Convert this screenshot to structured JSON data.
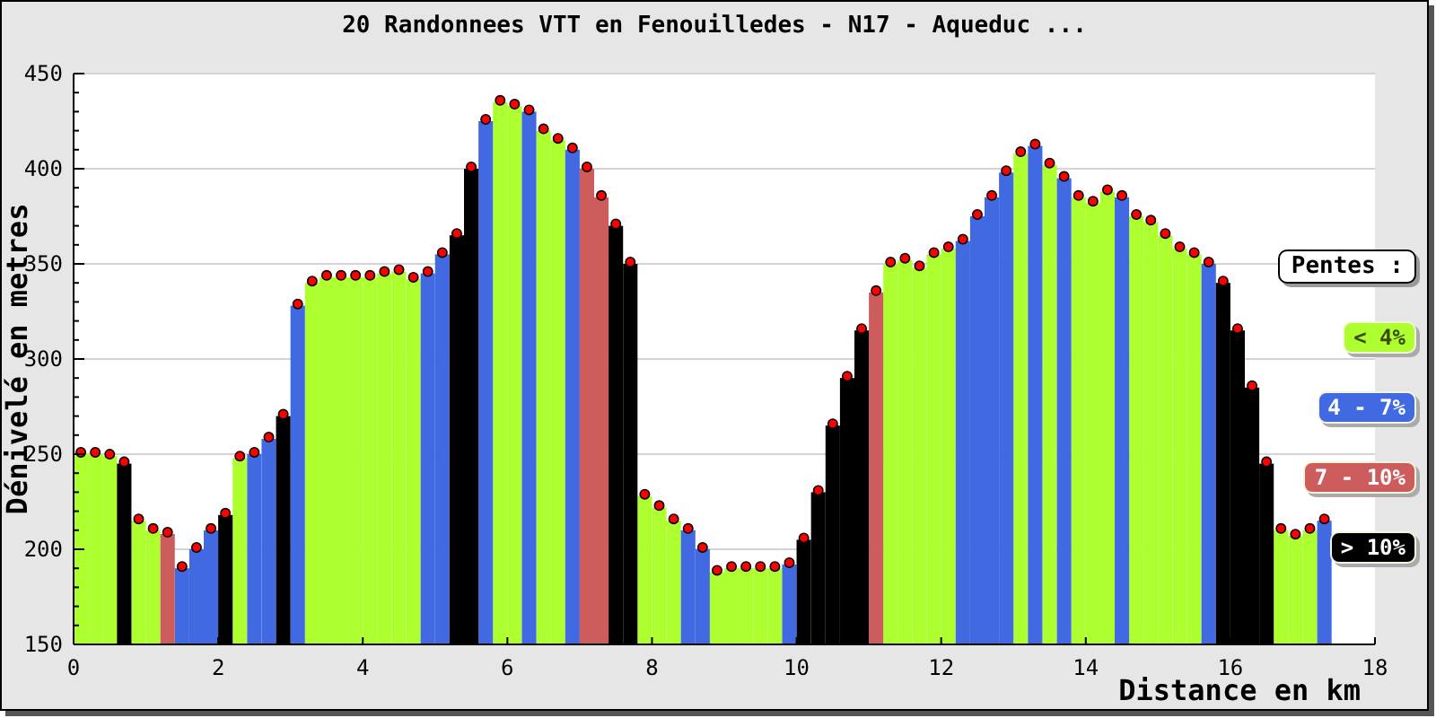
{
  "title": "20 Randonnees VTT en Fenouilledes - N17 - Aqueduc ...",
  "chart_data": {
    "type": "bar",
    "grid": true,
    "xlabel": "Distance en km",
    "ylabel": "Dénivelé en metres",
    "x": [
      0.1,
      0.3,
      0.5,
      0.7,
      0.9,
      1.1,
      1.3,
      1.5,
      1.7,
      1.9,
      2.1,
      2.3,
      2.5,
      2.7,
      2.9,
      3.1,
      3.3,
      3.5,
      3.7,
      3.9,
      4.1,
      4.3,
      4.5,
      4.7,
      4.9,
      5.1,
      5.3,
      5.5,
      5.7,
      5.9,
      6.1,
      6.3,
      6.5,
      6.7,
      6.9,
      7.1,
      7.3,
      7.5,
      7.7,
      7.9,
      8.1,
      8.3,
      8.5,
      8.7,
      8.9,
      9.1,
      9.3,
      9.5,
      9.7,
      9.9,
      10.1,
      10.3,
      10.5,
      10.7,
      10.9,
      11.1,
      11.3,
      11.5,
      11.7,
      11.9,
      12.1,
      12.3,
      12.5,
      12.7,
      12.9,
      13.1,
      13.3,
      13.5,
      13.7,
      13.9,
      14.1,
      14.3,
      14.5,
      14.7,
      14.9,
      15.1,
      15.3,
      15.5,
      15.7,
      15.9,
      16.1,
      16.3,
      16.5,
      16.7,
      16.9,
      17.1,
      17.3
    ],
    "series": [
      {
        "name": "< 4%",
        "color": "#adff2f",
        "values": [
          250,
          250,
          249,
          null,
          215,
          210,
          null,
          null,
          null,
          null,
          null,
          248,
          null,
          null,
          null,
          null,
          340,
          343,
          343,
          343,
          343,
          345,
          346,
          342,
          null,
          null,
          null,
          null,
          null,
          435,
          433,
          null,
          420,
          415,
          null,
          null,
          null,
          null,
          null,
          228,
          222,
          215,
          null,
          null,
          188,
          190,
          190,
          190,
          190,
          null,
          null,
          null,
          null,
          null,
          null,
          null,
          350,
          352,
          348,
          355,
          358,
          null,
          null,
          null,
          null,
          408,
          null,
          402,
          null,
          385,
          382,
          388,
          null,
          375,
          372,
          365,
          358,
          355,
          null,
          null,
          null,
          null,
          null,
          210,
          207,
          210,
          null
        ]
      },
      {
        "name": "4 - 7%",
        "color": "#4169e1",
        "values": [
          null,
          null,
          null,
          null,
          null,
          null,
          null,
          190,
          200,
          210,
          null,
          null,
          250,
          258,
          null,
          328,
          null,
          null,
          null,
          null,
          null,
          null,
          null,
          null,
          345,
          355,
          null,
          null,
          425,
          null,
          null,
          430,
          null,
          null,
          410,
          null,
          null,
          null,
          null,
          null,
          null,
          null,
          210,
          200,
          null,
          null,
          null,
          null,
          null,
          192,
          null,
          null,
          null,
          null,
          null,
          null,
          null,
          null,
          null,
          null,
          null,
          362,
          375,
          385,
          398,
          null,
          412,
          null,
          395,
          null,
          null,
          null,
          385,
          null,
          null,
          null,
          null,
          null,
          350,
          null,
          null,
          null,
          null,
          null,
          null,
          null,
          215
        ]
      },
      {
        "name": "7 - 10%",
        "color": "#cd5c5c",
        "values": [
          null,
          null,
          null,
          null,
          null,
          null,
          208,
          null,
          null,
          null,
          null,
          null,
          null,
          null,
          null,
          null,
          null,
          null,
          null,
          null,
          null,
          null,
          null,
          null,
          null,
          null,
          null,
          null,
          null,
          null,
          null,
          null,
          null,
          null,
          null,
          400,
          385,
          null,
          null,
          null,
          null,
          null,
          null,
          null,
          null,
          null,
          null,
          null,
          null,
          null,
          null,
          null,
          null,
          null,
          null,
          335,
          null,
          null,
          null,
          null,
          null,
          null,
          null,
          null,
          null,
          null,
          null,
          null,
          null,
          null,
          null,
          null,
          null,
          null,
          null,
          null,
          null,
          null,
          null,
          null,
          null,
          null,
          null,
          null,
          null,
          null,
          null
        ]
      },
      {
        "name": "> 10%",
        "color": "#000000",
        "values": [
          null,
          null,
          null,
          245,
          null,
          null,
          null,
          null,
          null,
          null,
          218,
          null,
          null,
          null,
          270,
          null,
          null,
          null,
          null,
          null,
          null,
          null,
          null,
          null,
          null,
          null,
          365,
          400,
          null,
          null,
          null,
          null,
          null,
          null,
          null,
          null,
          null,
          370,
          350,
          null,
          null,
          null,
          null,
          null,
          null,
          null,
          null,
          null,
          null,
          null,
          205,
          230,
          265,
          290,
          315,
          null,
          null,
          null,
          null,
          null,
          null,
          null,
          null,
          null,
          null,
          null,
          null,
          null,
          null,
          null,
          null,
          null,
          null,
          null,
          null,
          null,
          null,
          null,
          null,
          340,
          315,
          285,
          245,
          null,
          null,
          null,
          null
        ]
      }
    ],
    "xlim": [
      0,
      18
    ],
    "ylim": [
      150,
      450
    ],
    "xticks": [
      0,
      2,
      4,
      6,
      8,
      10,
      12,
      14,
      16,
      18
    ],
    "yticks": [
      150,
      200,
      250,
      300,
      350,
      400,
      450
    ]
  },
  "legend_title": "Pentes :"
}
